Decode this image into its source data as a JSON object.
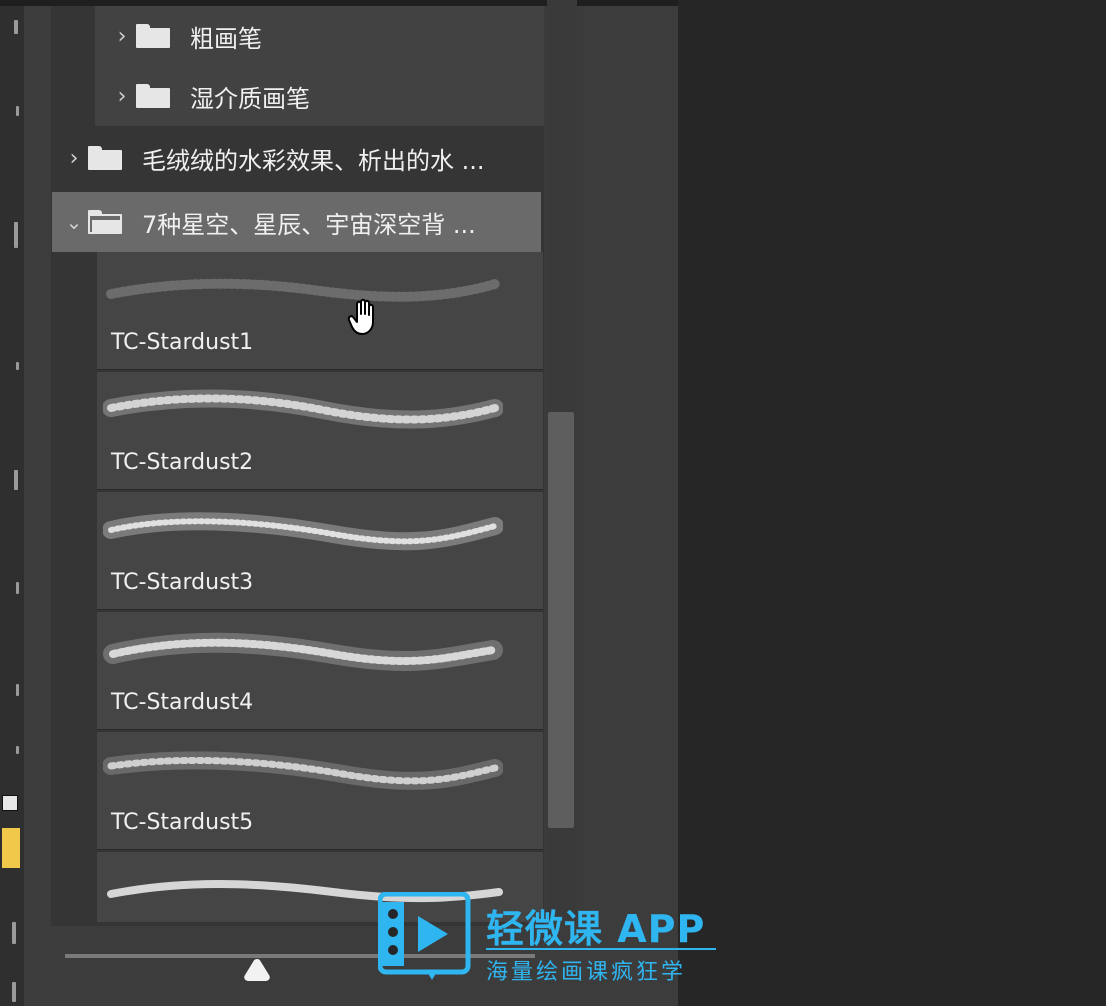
{
  "tree": {
    "rows": [
      {
        "label": "粗画笔",
        "expanded": false,
        "level": 2
      },
      {
        "label": "湿介质画笔",
        "expanded": false,
        "level": 2
      },
      {
        "label": "毛绒绒的水彩效果、析出的水 ...",
        "expanded": false,
        "level": 1
      },
      {
        "label": "7种星空、星辰、宇宙深空背 ...",
        "expanded": true,
        "level": 1,
        "selected": true
      }
    ]
  },
  "brushes": [
    {
      "name": "TC-Stardust1"
    },
    {
      "name": "TC-Stardust2"
    },
    {
      "name": "TC-Stardust3"
    },
    {
      "name": "TC-Stardust4"
    },
    {
      "name": "TC-Stardust5"
    },
    {
      "name": ""
    }
  ],
  "watermark": {
    "title": "轻微课 APP",
    "subtitle": "海量绘画课疯狂学",
    "color": "#2fb5f0"
  },
  "colors": {
    "panel": "#3c3c3c",
    "selected_row": "#6a6a6a",
    "foreground_swatch": "#f1c84a"
  },
  "icons": {
    "collapsed": "chevron-right-icon",
    "expanded": "chevron-down-icon",
    "folder": "folder-icon",
    "cursor": "hand-cursor-icon"
  }
}
